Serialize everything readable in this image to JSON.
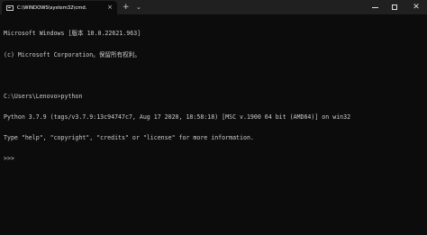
{
  "window": {
    "tab_title": "C:\\WINDOWS\\system32\\cmd.",
    "tab_close": "×",
    "new_tab": "+",
    "dropdown": "⌄",
    "close_glyph": "✕"
  },
  "terminal": {
    "lines": [
      "Microsoft Windows [版本 10.0.22621.963]",
      "(c) Microsoft Corporation。保留所有权利。",
      "",
      "C:\\Users\\Lenovo>python",
      "Python 3.7.9 (tags/v3.7.9:13c94747c7, Aug 17 2020, 18:58:18) [MSC v.1900 64 bit (AMD64)] on win32",
      "Type \"help\", \"copyright\", \"credits\" or \"license\" for more information.",
      ">>> "
    ]
  }
}
